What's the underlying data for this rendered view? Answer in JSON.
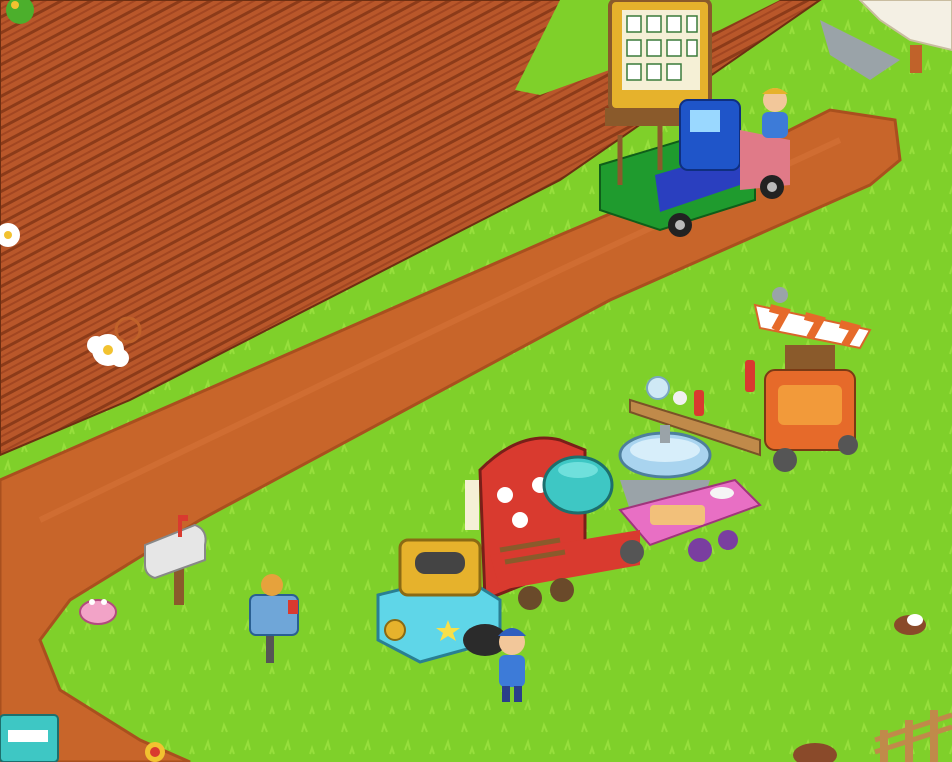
{
  "game": {
    "title": "",
    "hud": []
  },
  "colors": {
    "grass": "#7fd02a",
    "grass_light": "#9be03c",
    "road": "#c8652a",
    "road_dark": "#a9501e",
    "field": "#b9572a",
    "field_row": "#8c3b19",
    "truck_bed": "#1f9b2e",
    "truck_cab": "#1f55c9",
    "stall_red": "#d93a2f",
    "stall_teal": "#3ec7c4",
    "stall_pink": "#e86fc4",
    "wood": "#8a5a2b"
  },
  "objects": [
    {
      "id": "farm-field",
      "icon": "field-plots"
    },
    {
      "id": "dirt-road",
      "icon": "road"
    },
    {
      "id": "order-board",
      "icon": "board-icon"
    },
    {
      "id": "delivery-truck",
      "icon": "truck-icon"
    },
    {
      "id": "truck-driver",
      "icon": "farmer-icon"
    },
    {
      "id": "roadside-shop",
      "icon": "stall-icon"
    },
    {
      "id": "food-cart",
      "icon": "cart-icon"
    },
    {
      "id": "cooking-pot",
      "icon": "pot-icon"
    },
    {
      "id": "grill-machine",
      "icon": "machine-icon"
    },
    {
      "id": "mailbox",
      "icon": "mailbox-icon"
    },
    {
      "id": "scarecrow-post",
      "icon": "post-icon"
    },
    {
      "id": "farmer",
      "icon": "farmer-icon"
    },
    {
      "id": "flower-bush",
      "icon": "flower-icon"
    },
    {
      "id": "dog",
      "icon": "dog-icon"
    },
    {
      "id": "fence",
      "icon": "fence-icon"
    }
  ]
}
